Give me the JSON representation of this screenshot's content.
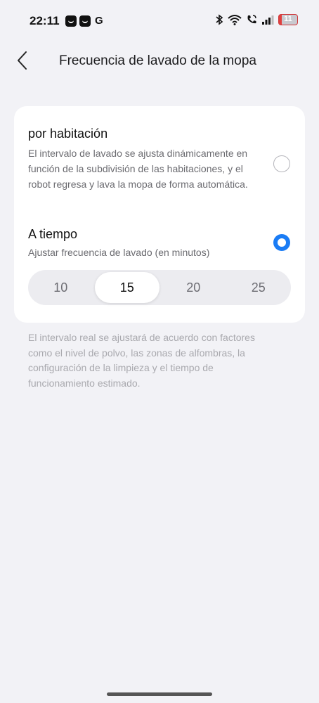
{
  "status_bar": {
    "time": "22:11",
    "notif_letter": "G",
    "battery": "11",
    "battery_color": "#e0403f"
  },
  "header": {
    "title": "Frecuencia de lavado de la mopa",
    "back_icon": "chevron-left-icon"
  },
  "options": [
    {
      "title": "por habitación",
      "description": "El intervalo de lavado se ajusta dinámicamente en función de la subdivisión de las habitaciones, y el robot regresa y lava la mopa de forma automática.",
      "selected": false
    },
    {
      "title": "A tiempo",
      "description": "Ajustar frecuencia de lavado (en minutos)",
      "selected": true
    }
  ],
  "interval": {
    "values": [
      "10",
      "15",
      "20",
      "25"
    ],
    "selected": "15"
  },
  "footnote": "El intervalo real se ajustará de acuerdo con factores como el nivel de polvo, las zonas de alfombras, la configuración de la limpieza y el tiempo de funcionamiento estimado.",
  "accent_color": "#1a7cf5"
}
